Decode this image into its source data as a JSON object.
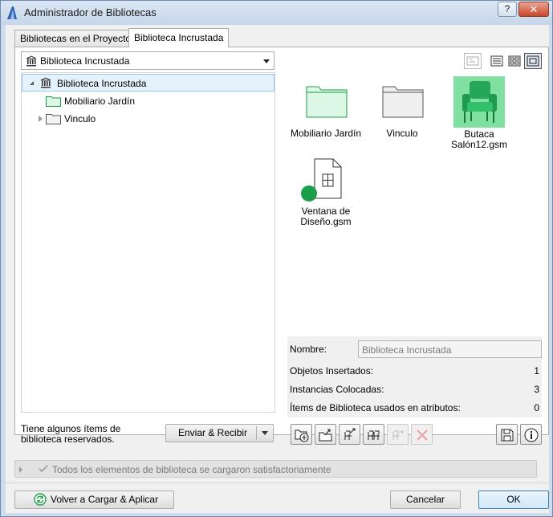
{
  "window": {
    "title": "Administrador de Bibliotecas",
    "help_label": "?",
    "close_label": "✕"
  },
  "tabs": [
    {
      "label": "Bibliotecas en el Proyecto",
      "active": false
    },
    {
      "label": "Biblioteca Incrustada",
      "active": true
    }
  ],
  "library_selector": {
    "selected": "Biblioteca Incrustada"
  },
  "tree": {
    "items": [
      {
        "label": "Biblioteca Incrustada",
        "icon": "library-icon",
        "expanded": true,
        "selected": true
      },
      {
        "label": "Mobiliario Jardín",
        "icon": "folder-green-icon"
      },
      {
        "label": "Vinculo",
        "icon": "folder-icon",
        "expanded": false
      }
    ]
  },
  "view_modes": [
    "tree-view-icon",
    "list-view-icon",
    "icon-view-icon",
    "preview-view-icon"
  ],
  "preview_items": [
    {
      "caption": "Mobiliario Jardín",
      "icon": "folder-green-icon"
    },
    {
      "caption": "Vinculo",
      "icon": "folder-icon"
    },
    {
      "caption": "Butaca Salón12.gsm",
      "icon": "armchair-icon"
    },
    {
      "caption": "Ventana de Diseño.gsm",
      "icon": "window-file-icon"
    }
  ],
  "info": {
    "name_label": "Nombre:",
    "name_value": "Biblioteca Incrustada",
    "inserted_label": "Objetos Insertados:",
    "inserted_value": "1",
    "placed_label": "Instancias Colocadas:",
    "placed_value": "3",
    "attr_label": "Ítems de Biblioteca usados en atributos:",
    "attr_value": "0"
  },
  "reserved_notice": "Tiene algunos ítems de biblioteca reservados.",
  "send_receive_label": "Enviar & Recibir",
  "toolbar_icons": [
    "add-file-icon",
    "import-folder-icon",
    "export-object-icon",
    "group-objects-icon",
    "move-object-icon",
    "delete-icon",
    "save-icon",
    "info-icon"
  ],
  "status": {
    "message": "Todos los elementos de biblioteca se cargaron satisfactoriamente"
  },
  "footer": {
    "reload_label": "Volver a Cargar & Aplicar",
    "cancel_label": "Cancelar",
    "ok_label": "OK"
  },
  "colors": {
    "accent_green": "#1a9e4a",
    "folder_green": "#dcf7e3",
    "selection": "#e5f1fb"
  }
}
